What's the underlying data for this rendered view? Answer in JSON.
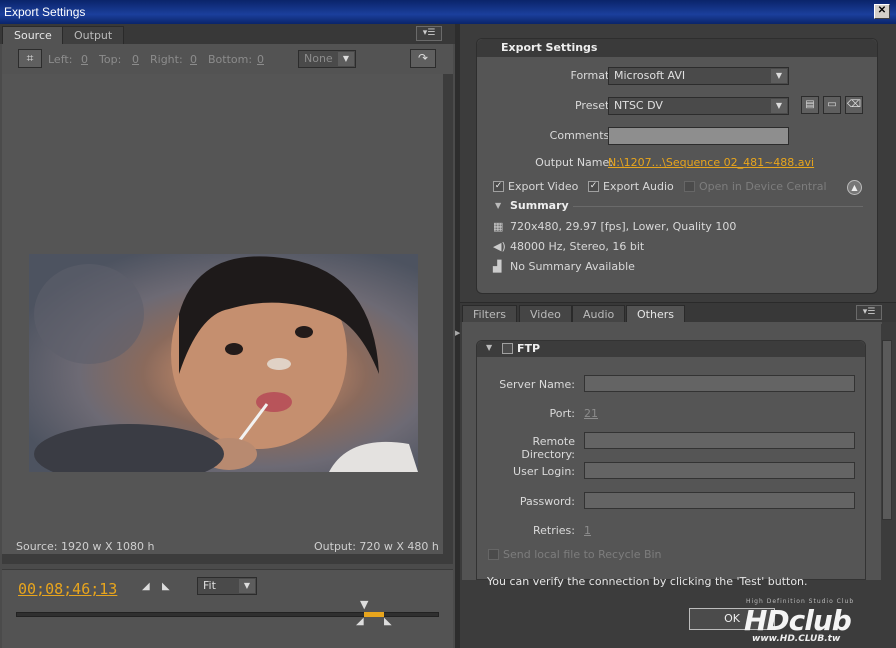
{
  "window": {
    "title": "Export Settings"
  },
  "left": {
    "tabs": [
      "Source",
      "Output"
    ],
    "crop": {
      "left_label": "Left:",
      "left_val": "0",
      "top_label": "Top:",
      "top_val": "0",
      "right_label": "Right:",
      "right_val": "0",
      "bottom_label": "Bottom:",
      "bottom_val": "0",
      "ratio": "None"
    },
    "source_info": "Source: 1920 w X 1080 h",
    "output_info": "Output: 720 w X 480 h",
    "timecode": "00;08;46;13",
    "zoom": "Fit"
  },
  "export": {
    "header": "Export Settings",
    "format_label": "Format:",
    "format_value": "Microsoft AVI",
    "preset_label": "Preset:",
    "preset_value": "NTSC DV",
    "comments_label": "Comments:",
    "output_name_label": "Output Name:",
    "output_name_value": "N:\\1207...\\Sequence 02_481~488.avi",
    "export_video": "Export Video",
    "export_audio": "Export Audio",
    "device_central": "Open in Device Central",
    "summary_label": "Summary",
    "summary_video": "720x480, 29.97 [fps], Lower, Quality 100",
    "summary_audio": "48000 Hz, Stereo, 16 bit",
    "summary_none": "No Summary Available"
  },
  "tabs": [
    "Filters",
    "Video",
    "Audio",
    "Others"
  ],
  "ftp": {
    "title": "FTP",
    "server_label": "Server Name:",
    "port_label": "Port:",
    "port_value": "21",
    "remote_label": "Remote Directory:",
    "login_label": "User Login:",
    "password_label": "Password:",
    "retries_label": "Retries:",
    "retries_value": "1",
    "recycle_label": "Send local file to Recycle Bin",
    "verify_text": "You can verify the connection by clicking the 'Test' button."
  },
  "buttons": {
    "ok": "OK"
  },
  "watermark": {
    "brand": "HDclub",
    "tagline": "High Definition Studio Club",
    "url": "www.HD.CLUB.tw"
  },
  "colors": {
    "timecode": "#e8a51d",
    "output_link": "#e8a51d"
  }
}
